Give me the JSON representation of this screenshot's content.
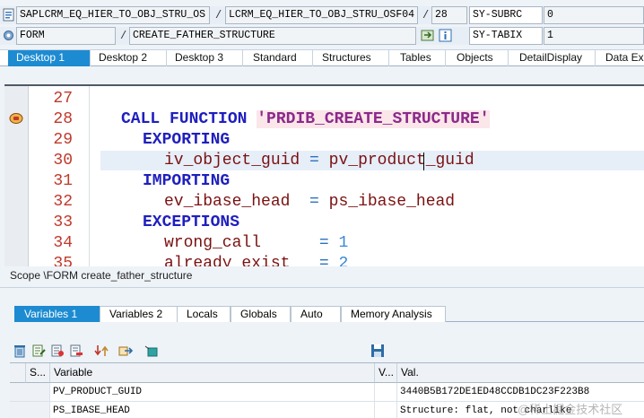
{
  "header": {
    "row1": {
      "program": "SAPLCRM_EQ_HIER_TO_OBJ_STRU_OS",
      "include": "LCRM_EQ_HIER_TO_OBJ_STRU_OSF04",
      "line": "28",
      "sysfield_name": "SY-SUBRC",
      "sysfield_value": "0"
    },
    "row2": {
      "event_type": "FORM",
      "event_name": "CREATE_FATHER_STRUCTURE",
      "sysfield_name": "SY-TABIX",
      "sysfield_value": "1"
    },
    "separator": "/"
  },
  "desktop_tabs": [
    "Desktop 1",
    "Desktop 2",
    "Desktop 3",
    "Standard",
    "Structures",
    "Tables",
    "Objects",
    "DetailDisplay",
    "Data Explorer"
  ],
  "editor": {
    "line_numbers": [
      "27",
      "28",
      "29",
      "30",
      "31",
      "32",
      "33",
      "34",
      "35"
    ],
    "lines": {
      "l28_kw": "CALL FUNCTION",
      "l28_str": "'PRDIB_CREATE_STRUCTURE'",
      "l29_kw": "EXPORTING",
      "l30_id": "iv_object_guid",
      "l30_op": "=",
      "l30_val": "pv_product_guid",
      "l31_kw": "IMPORTING",
      "l32_id": "ev_ibase_head",
      "l32_op": "=",
      "l32_val": "ps_ibase_head",
      "l33_kw": "EXCEPTIONS",
      "l34_id": "wrong_call",
      "l34_op": "=",
      "l34_val": "1",
      "l35_id": "already_exist",
      "l35_op": "=",
      "l35_val": "2"
    }
  },
  "scope": "Scope \\FORM create_father_structure",
  "variable_tabs": [
    "Variables 1",
    "Variables 2",
    "Locals",
    "Globals",
    "Auto",
    "Memory Analysis"
  ],
  "toolbar_icons": [
    "delete-icon",
    "edit-icon",
    "insert-icon",
    "remove-icon",
    "sort-icon",
    "export-icon",
    "transfer-icon",
    "save-icon"
  ],
  "table": {
    "columns": [
      "S...",
      "Variable",
      "V...",
      "Val."
    ],
    "rows": [
      {
        "variable": "PV_PRODUCT_GUID",
        "value": "3440B5B172DE1ED48CCDB1DC23F223B8"
      },
      {
        "variable": "PS_IBASE_HEAD",
        "value": "Structure: flat, not charlike"
      }
    ]
  },
  "watermark": "@稀土掘金技术社区",
  "colors": {
    "accent": "#1d8bd1",
    "keyword": "#1f1fbf",
    "line_number": "#c0392b"
  }
}
